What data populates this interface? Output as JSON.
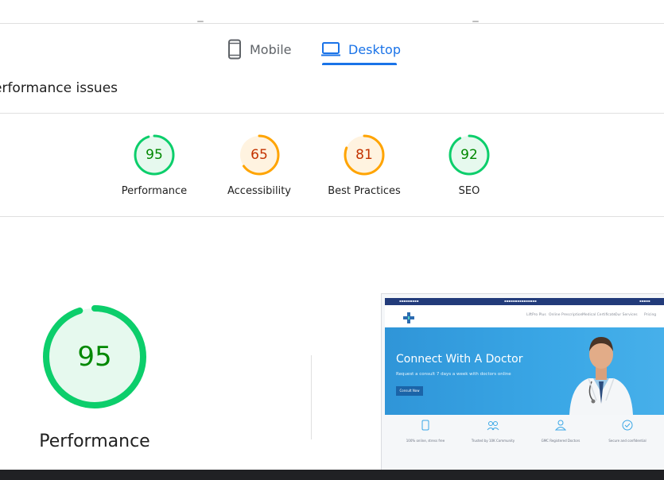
{
  "tabs": [
    {
      "label": "Mobile",
      "icon": "phone-icon",
      "active": false
    },
    {
      "label": "Desktop",
      "icon": "laptop-icon",
      "active": true
    }
  ],
  "section_title": "erformance issues",
  "categories": [
    {
      "score": "95",
      "label": "Performance",
      "status": "pass",
      "color": "#0cce6b",
      "text_color": "#008800",
      "fill": "#e6f9ee",
      "fraction": 0.95
    },
    {
      "score": "65",
      "label": "Accessibility",
      "status": "average",
      "color": "#ffa400",
      "text_color": "#c33300",
      "fill": "#fff3e0",
      "fraction": 0.65
    },
    {
      "score": "81",
      "label": "Best Practices",
      "status": "average",
      "color": "#ffa400",
      "text_color": "#c33300",
      "fill": "#fff3e0",
      "fraction": 0.81
    },
    {
      "score": "92",
      "label": "SEO",
      "status": "pass",
      "color": "#0cce6b",
      "text_color": "#008800",
      "fill": "#e6f9ee",
      "fraction": 0.92
    }
  ],
  "summary": {
    "score": "95",
    "label": "Performance",
    "color": "#0cce6b",
    "text_color": "#008800",
    "fill": "#e6f9ee",
    "fraction": 0.95
  },
  "page_screenshot": {
    "hero_title": "Connect With A Doctor",
    "hero_subtitle": "Request a consult 7 days a week with doctors online",
    "hero_button": "Consult Now",
    "nav_links": [
      "LiftPro Plus",
      "Online Prescription",
      "Medical Certificate",
      "Our Services",
      "Pricing"
    ],
    "features": [
      "100% online, stress free",
      "Trusted by 10K Community",
      "GMC Registered Doctors",
      "Secure and confidential"
    ],
    "brand_color": "#3aa7e6"
  },
  "partial_text": "... ... ... .. ... ... ... ... ... ... ..."
}
